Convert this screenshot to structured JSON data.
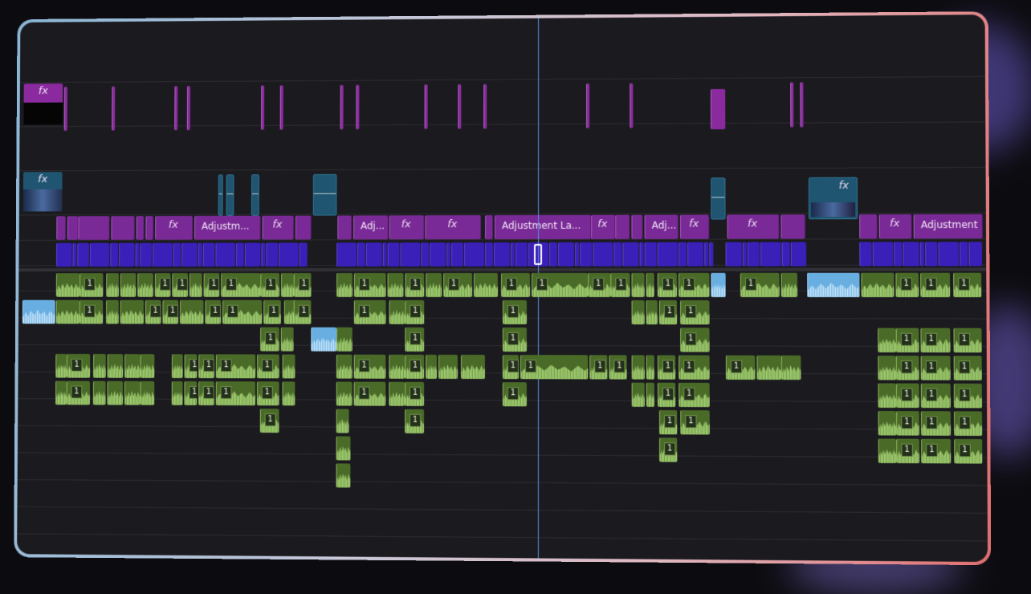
{
  "timeline": {
    "fx_icon": "fx",
    "labels": {
      "adjustment_1": "Adjustm...",
      "adjustment_2": "Adj...",
      "adjustment_3": "Adjustment La...",
      "adjustment_4": "Adj...",
      "adjustment_5": "Adjustment ..."
    },
    "clip_badge": "1"
  },
  "colors": {
    "fx_clip": "#8a2a9e",
    "adjustment_layer": "#7a2a96",
    "video_clip": "#3a1fb8",
    "audio_clip": "#4a6a28",
    "audio_light_blue": "#69aee0",
    "playhead": "#5a8ee6"
  }
}
